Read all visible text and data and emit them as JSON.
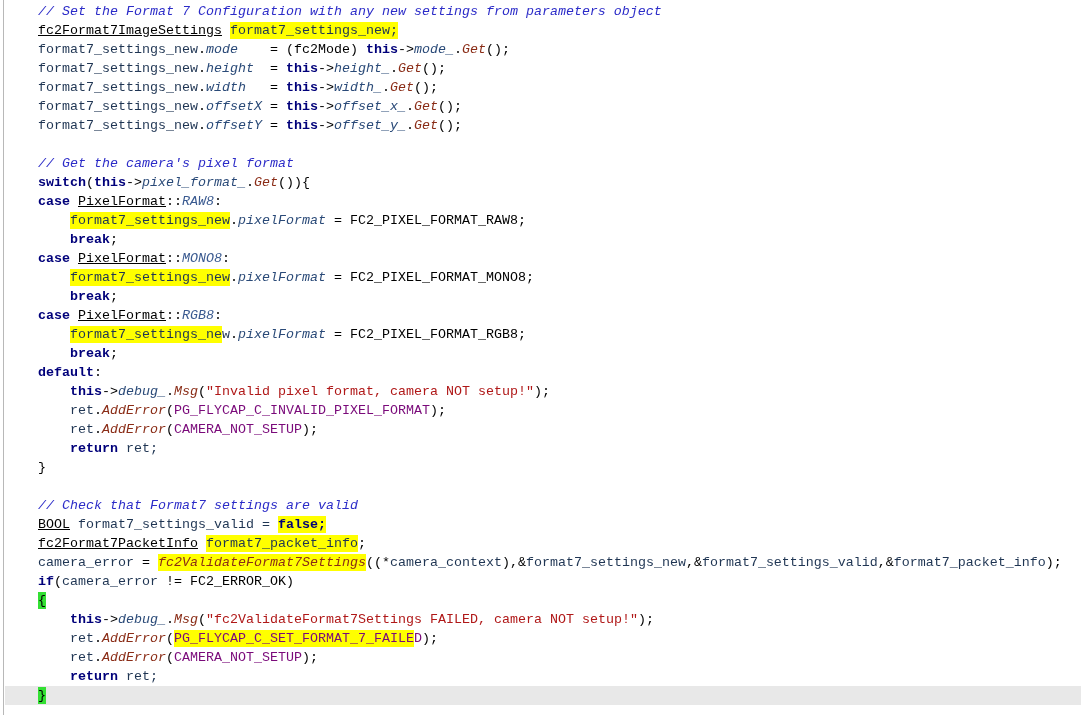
{
  "editor": {
    "lines": [
      {
        "kind": "code",
        "tokens": [
          {
            "kind": "comment",
            "text": "// Set the Format 7 Configuration with any new settings from parameters object"
          }
        ]
      },
      {
        "kind": "code",
        "tokens": [
          {
            "kind": "type",
            "text": "fc2Format7ImageSettings "
          },
          {
            "kind": "var",
            "text": "format7_settings_new;",
            "color": "#ffff00"
          }
        ]
      },
      {
        "kind": "code",
        "tokens": [
          {
            "kind": "var",
            "text": "format7_settings_new"
          },
          {
            "kind": "plain",
            "text": "."
          },
          {
            "kind": "field",
            "text": "mode"
          },
          {
            "kind": "plain",
            "text": "    = (fc2Mode) "
          },
          {
            "kind": "keyword",
            "text": "this"
          },
          {
            "kind": "plain",
            "text": "->"
          },
          {
            "kind": "field",
            "text": "mode_"
          },
          {
            "kind": "plain",
            "text": "."
          },
          {
            "kind": "method",
            "text": "Get"
          },
          {
            "kind": "plain",
            "text": "();"
          }
        ]
      },
      {
        "kind": "code",
        "tokens": [
          {
            "kind": "var",
            "text": "format7_settings_new"
          },
          {
            "kind": "plain",
            "text": "."
          },
          {
            "kind": "field",
            "text": "height"
          },
          {
            "kind": "plain",
            "text": "  = "
          },
          {
            "kind": "keyword",
            "text": "this"
          },
          {
            "kind": "plain",
            "text": "->"
          },
          {
            "kind": "field",
            "text": "height_"
          },
          {
            "kind": "plain",
            "text": "."
          },
          {
            "kind": "method",
            "text": "Get"
          },
          {
            "kind": "plain",
            "text": "();"
          }
        ]
      },
      {
        "kind": "code",
        "tokens": [
          {
            "kind": "var",
            "text": "format7_settings_new"
          },
          {
            "kind": "plain",
            "text": "."
          },
          {
            "kind": "field",
            "text": "width"
          },
          {
            "kind": "plain",
            "text": "   = "
          },
          {
            "kind": "keyword",
            "text": "this"
          },
          {
            "kind": "plain",
            "text": "->"
          },
          {
            "kind": "field",
            "text": "width_"
          },
          {
            "kind": "plain",
            "text": "."
          },
          {
            "kind": "method",
            "text": "Get"
          },
          {
            "kind": "plain",
            "text": "();"
          }
        ]
      },
      {
        "kind": "code",
        "tokens": [
          {
            "kind": "var",
            "text": "format7_settings_new"
          },
          {
            "kind": "plain",
            "text": "."
          },
          {
            "kind": "field",
            "text": "offsetX"
          },
          {
            "kind": "plain",
            "text": " = "
          },
          {
            "kind": "keyword",
            "text": "this"
          },
          {
            "kind": "plain",
            "text": "->"
          },
          {
            "kind": "field",
            "text": "offset_x_"
          },
          {
            "kind": "plain",
            "text": "."
          },
          {
            "kind": "method",
            "text": "Get"
          },
          {
            "kind": "plain",
            "text": "();"
          }
        ]
      },
      {
        "kind": "code",
        "tokens": [
          {
            "kind": "var",
            "text": "format7_settings_new"
          },
          {
            "kind": "plain",
            "text": "."
          },
          {
            "kind": "field",
            "text": "offsetY"
          },
          {
            "kind": "plain",
            "text": " = "
          },
          {
            "kind": "keyword",
            "text": "this"
          },
          {
            "kind": "plain",
            "text": "->"
          },
          {
            "kind": "field",
            "text": "offset_y_"
          },
          {
            "kind": "plain",
            "text": "."
          },
          {
            "kind": "method",
            "text": "Get"
          },
          {
            "kind": "plain",
            "text": "();"
          }
        ]
      },
      {
        "kind": "blank"
      },
      {
        "kind": "code",
        "tokens": [
          {
            "kind": "comment",
            "text": "// Get the camera's pixel format"
          }
        ]
      },
      {
        "kind": "code",
        "tokens": [
          {
            "kind": "keyword",
            "text": "switch"
          },
          {
            "kind": "plain",
            "text": "("
          },
          {
            "kind": "keyword",
            "text": "this"
          },
          {
            "kind": "plain",
            "text": "->"
          },
          {
            "kind": "field",
            "text": "pixel_format_"
          },
          {
            "kind": "plain",
            "text": "."
          },
          {
            "kind": "method",
            "text": "Get"
          },
          {
            "kind": "plain",
            "text": "()){"
          }
        ]
      },
      {
        "kind": "code",
        "tokens": [
          {
            "kind": "keyword",
            "text": "case "
          },
          {
            "kind": "type",
            "text": "PixelFormat"
          },
          {
            "kind": "plain",
            "text": "::"
          },
          {
            "kind": "enum",
            "text": "RAW8"
          },
          {
            "kind": "plain",
            "text": ":"
          }
        ]
      },
      {
        "kind": "code",
        "indented": true,
        "tokens": [
          {
            "kind": "var",
            "text": "format7_settings_new",
            "color": "#ffff00"
          },
          {
            "kind": "plain",
            "text": "."
          },
          {
            "kind": "field",
            "text": "pixelFormat"
          },
          {
            "kind": "plain",
            "text": " = FC2_PIXEL_FORMAT_RAW8;"
          }
        ]
      },
      {
        "kind": "code",
        "indented": true,
        "tokens": [
          {
            "kind": "keyword",
            "text": "break"
          },
          {
            "kind": "plain",
            "text": ";"
          }
        ]
      },
      {
        "kind": "code",
        "tokens": [
          {
            "kind": "keyword",
            "text": "case "
          },
          {
            "kind": "type",
            "text": "PixelFormat"
          },
          {
            "kind": "plain",
            "text": "::"
          },
          {
            "kind": "enum",
            "text": "MONO8"
          },
          {
            "kind": "plain",
            "text": ":"
          }
        ]
      },
      {
        "kind": "code",
        "indented": true,
        "tokens": [
          {
            "kind": "var",
            "text": "format7_settings_new",
            "color": "#ffff00"
          },
          {
            "kind": "plain",
            "text": "."
          },
          {
            "kind": "field",
            "text": "pixelFormat"
          },
          {
            "kind": "plain",
            "text": " = FC2_PIXEL_FORMAT_MONO8;"
          }
        ]
      },
      {
        "kind": "code",
        "indented": true,
        "tokens": [
          {
            "kind": "keyword",
            "text": "break"
          },
          {
            "kind": "plain",
            "text": ";"
          }
        ]
      },
      {
        "kind": "code",
        "tokens": [
          {
            "kind": "keyword",
            "text": "case "
          },
          {
            "kind": "type",
            "text": "PixelFormat"
          },
          {
            "kind": "plain",
            "text": "::"
          },
          {
            "kind": "enum",
            "text": "RGB8"
          },
          {
            "kind": "plain",
            "text": ":"
          }
        ]
      },
      {
        "kind": "code",
        "indented": true,
        "tokens": [
          {
            "kind": "var",
            "text": "format7_settings_ne",
            "color": "#ffff00"
          },
          {
            "kind": "var",
            "text": "w"
          },
          {
            "kind": "plain",
            "text": "."
          },
          {
            "kind": "field",
            "text": "pixelFormat"
          },
          {
            "kind": "plain",
            "text": " = FC2_PIXEL_FORMAT_RGB8;"
          }
        ]
      },
      {
        "kind": "code",
        "indented": true,
        "tokens": [
          {
            "kind": "keyword",
            "text": "break"
          },
          {
            "kind": "plain",
            "text": ";"
          }
        ]
      },
      {
        "kind": "code",
        "tokens": [
          {
            "kind": "keyword",
            "text": "default"
          },
          {
            "kind": "plain",
            "text": ":"
          }
        ]
      },
      {
        "kind": "code",
        "indented": true,
        "tokens": [
          {
            "kind": "keyword",
            "text": "this"
          },
          {
            "kind": "plain",
            "text": "->"
          },
          {
            "kind": "field",
            "text": "debug_"
          },
          {
            "kind": "plain",
            "text": "."
          },
          {
            "kind": "method",
            "text": "Msg"
          },
          {
            "kind": "plain",
            "text": "("
          },
          {
            "kind": "string",
            "text": "\"Invalid pixel format, camera NOT setup!\""
          },
          {
            "kind": "plain",
            "text": ");"
          }
        ]
      },
      {
        "kind": "code",
        "indented": true,
        "tokens": [
          {
            "kind": "var",
            "text": "ret"
          },
          {
            "kind": "plain",
            "text": "."
          },
          {
            "kind": "method",
            "text": "AddError"
          },
          {
            "kind": "plain",
            "text": "("
          },
          {
            "kind": "macro",
            "text": "PG_FLYCAP_C_INVALID_PIXEL_FORMAT"
          },
          {
            "kind": "plain",
            "text": ");"
          }
        ]
      },
      {
        "kind": "code",
        "indented": true,
        "tokens": [
          {
            "kind": "var",
            "text": "ret"
          },
          {
            "kind": "plain",
            "text": "."
          },
          {
            "kind": "method",
            "text": "AddError"
          },
          {
            "kind": "plain",
            "text": "("
          },
          {
            "kind": "macro",
            "text": "CAMERA_NOT_SETUP"
          },
          {
            "kind": "plain",
            "text": ");"
          }
        ]
      },
      {
        "kind": "code",
        "indented": true,
        "tokens": [
          {
            "kind": "keyword",
            "text": "return "
          },
          {
            "kind": "var",
            "text": "ret;"
          }
        ]
      },
      {
        "kind": "code",
        "tokens": [
          {
            "kind": "plain",
            "text": "}"
          }
        ]
      },
      {
        "kind": "blank"
      },
      {
        "kind": "code",
        "tokens": [
          {
            "kind": "comment",
            "text": "// Check that Format7 settings are valid"
          }
        ]
      },
      {
        "kind": "code",
        "tokens": [
          {
            "kind": "type",
            "text": "BOOL "
          },
          {
            "kind": "var",
            "text": "format7_settings_valid = "
          },
          {
            "kind": "keyword",
            "text": "false;",
            "color": "#ffff00"
          }
        ]
      },
      {
        "kind": "code",
        "tokens": [
          {
            "kind": "type",
            "text": "fc2Format7PacketInfo "
          },
          {
            "kind": "var",
            "text": "format7_packet_info",
            "color": "#ffff00"
          },
          {
            "kind": "plain",
            "text": ";"
          }
        ]
      },
      {
        "kind": "code",
        "tokens": [
          {
            "kind": "var",
            "text": "camera_error"
          },
          {
            "kind": "plain",
            "text": " = "
          },
          {
            "kind": "method",
            "text": "fc2ValidateFormat7Settings",
            "color": "#ffff00"
          },
          {
            "kind": "plain",
            "text": "((*"
          },
          {
            "kind": "var",
            "text": "camera_context"
          },
          {
            "kind": "plain",
            "text": "),&"
          },
          {
            "kind": "var",
            "text": "format7_settings_new"
          },
          {
            "kind": "plain",
            "text": ",&"
          },
          {
            "kind": "var",
            "text": "format7_settings_valid"
          },
          {
            "kind": "plain",
            "text": ",&"
          },
          {
            "kind": "var",
            "text": "format7_packet_info"
          },
          {
            "kind": "plain",
            "text": ");"
          }
        ]
      },
      {
        "kind": "code",
        "tokens": [
          {
            "kind": "keyword",
            "text": "if"
          },
          {
            "kind": "plain",
            "text": "("
          },
          {
            "kind": "var",
            "text": "camera_error"
          },
          {
            "kind": "plain",
            "text": " != FC2_ERROR_OK)"
          }
        ]
      },
      {
        "kind": "code",
        "tokens": [
          {
            "kind": "plain",
            "text": "{",
            "color": "#33e033"
          }
        ]
      },
      {
        "kind": "code",
        "indented": true,
        "tokens": [
          {
            "kind": "keyword",
            "text": "this"
          },
          {
            "kind": "plain",
            "text": "->"
          },
          {
            "kind": "field",
            "text": "debug_"
          },
          {
            "kind": "plain",
            "text": "."
          },
          {
            "kind": "method",
            "text": "Msg"
          },
          {
            "kind": "plain",
            "text": "("
          },
          {
            "kind": "string",
            "text": "\"fc2ValidateFormat7Settings FAILED, camera NOT setup!\""
          },
          {
            "kind": "plain",
            "text": ");"
          }
        ]
      },
      {
        "kind": "code",
        "indented": true,
        "tokens": [
          {
            "kind": "var",
            "text": "ret"
          },
          {
            "kind": "plain",
            "text": "."
          },
          {
            "kind": "method",
            "text": "AddError"
          },
          {
            "kind": "plain",
            "text": "("
          },
          {
            "kind": "macro",
            "text": "PG_FLYCAP_C_SET_FORMAT_7_FAILE",
            "color": "#ffff00"
          },
          {
            "kind": "macro",
            "text": "D"
          },
          {
            "kind": "plain",
            "text": ");"
          }
        ]
      },
      {
        "kind": "code",
        "indented": true,
        "tokens": [
          {
            "kind": "var",
            "text": "ret"
          },
          {
            "kind": "plain",
            "text": "."
          },
          {
            "kind": "method",
            "text": "AddError"
          },
          {
            "kind": "plain",
            "text": "("
          },
          {
            "kind": "macro",
            "text": "CAMERA_NOT_SETUP"
          },
          {
            "kind": "plain",
            "text": ");"
          }
        ]
      },
      {
        "kind": "code",
        "indented": true,
        "tokens": [
          {
            "kind": "keyword",
            "text": "return "
          },
          {
            "kind": "var",
            "text": "ret;"
          }
        ]
      },
      {
        "kind": "code",
        "current": true,
        "tokens": [
          {
            "kind": "plain",
            "text": "}",
            "color": "#33e033"
          }
        ]
      }
    ]
  }
}
